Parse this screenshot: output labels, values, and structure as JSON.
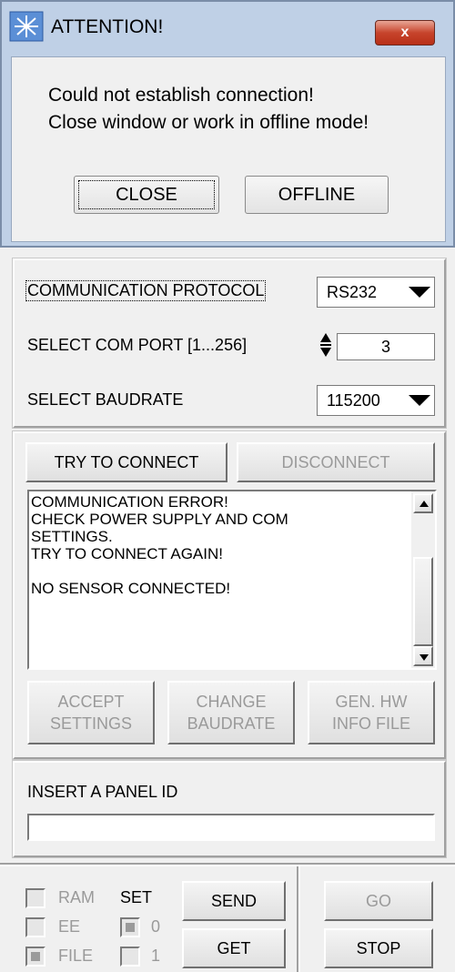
{
  "dialog": {
    "title": "ATTENTION!",
    "close_glyph": "x",
    "message_line1": "Could not establish connection!",
    "message_line2": "Close window or work in offline mode!",
    "close_button": "CLOSE",
    "offline_button": "OFFLINE"
  },
  "connection": {
    "protocol_label": "COMMUNICATION PROTOCOL",
    "protocol_value": "RS232",
    "port_label": "SELECT COM PORT [1...256]",
    "port_value": "3",
    "baud_label": "SELECT BAUDRATE",
    "baud_value": "115200"
  },
  "actions": {
    "connect": "TRY TO CONNECT",
    "disconnect": "DISCONNECT",
    "log": "COMMUNICATION ERROR!\nCHECK POWER SUPPLY AND COM\nSETTINGS.\nTRY TO CONNECT AGAIN!\n\nNO SENSOR CONNECTED!",
    "accept_1": "ACCEPT",
    "accept_2": "SETTINGS",
    "change_1": "CHANGE",
    "change_2": "BAUDRATE",
    "gen_1": "GEN. HW",
    "gen_2": "INFO FILE"
  },
  "panel_id": {
    "label": "INSERT A PANEL ID",
    "value": ""
  },
  "bottom": {
    "ram": "RAM",
    "ee": "EE",
    "file": "FILE",
    "set": "SET",
    "set_0": "0",
    "set_1": "1",
    "send": "SEND",
    "get": "GET",
    "go": "GO",
    "stop": "STOP"
  },
  "colors": {
    "dialog_frame": "#bfd0e6",
    "close_red": "#c7442c"
  }
}
